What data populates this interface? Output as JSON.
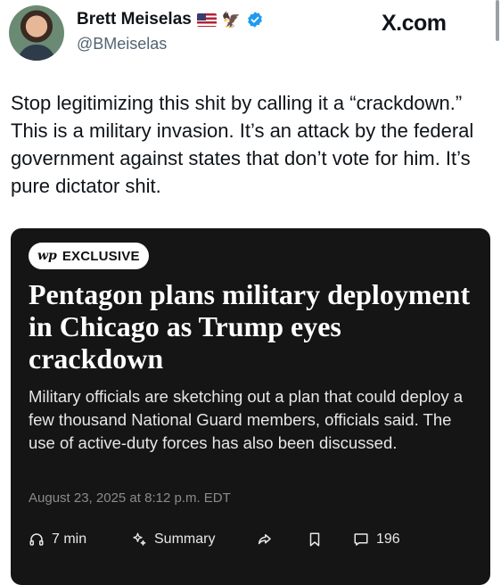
{
  "profile": {
    "name": "Brett Meiselas",
    "handle": "@BMeiselas",
    "flag_icon": "us-flag-icon",
    "emoji_icon": "eagle-icon",
    "verified_icon": "verified-badge-icon",
    "verified_color": "#1d9bf0"
  },
  "site": {
    "label": "X.com"
  },
  "tweet": {
    "text": "Stop legitimizing this shit by calling it a “crackdown.” This is a military invasion. It’s an attack by the federal government against states that don’t vote for him. It’s pure dictator shit."
  },
  "card": {
    "badge_logo": "wp",
    "badge_label": "EXCLUSIVE",
    "headline": "Pentagon plans military deployment in Chicago as Trump eyes crackdown",
    "summary": "Military officials are sketching out a plan that could deploy a few thousand National Guard members, officials said. The use of active-duty forces has also been discussed.",
    "date": "August 23, 2025 at 8:12 p.m. EDT",
    "background_color": "#151515",
    "actions": {
      "listen": {
        "icon": "headphones-icon",
        "label": "7 min"
      },
      "summary": {
        "icon": "sparkle-icon",
        "label": "Summary"
      },
      "share": {
        "icon": "share-icon"
      },
      "save": {
        "icon": "bookmark-icon"
      },
      "comments": {
        "icon": "comment-icon",
        "label": "196"
      }
    }
  }
}
